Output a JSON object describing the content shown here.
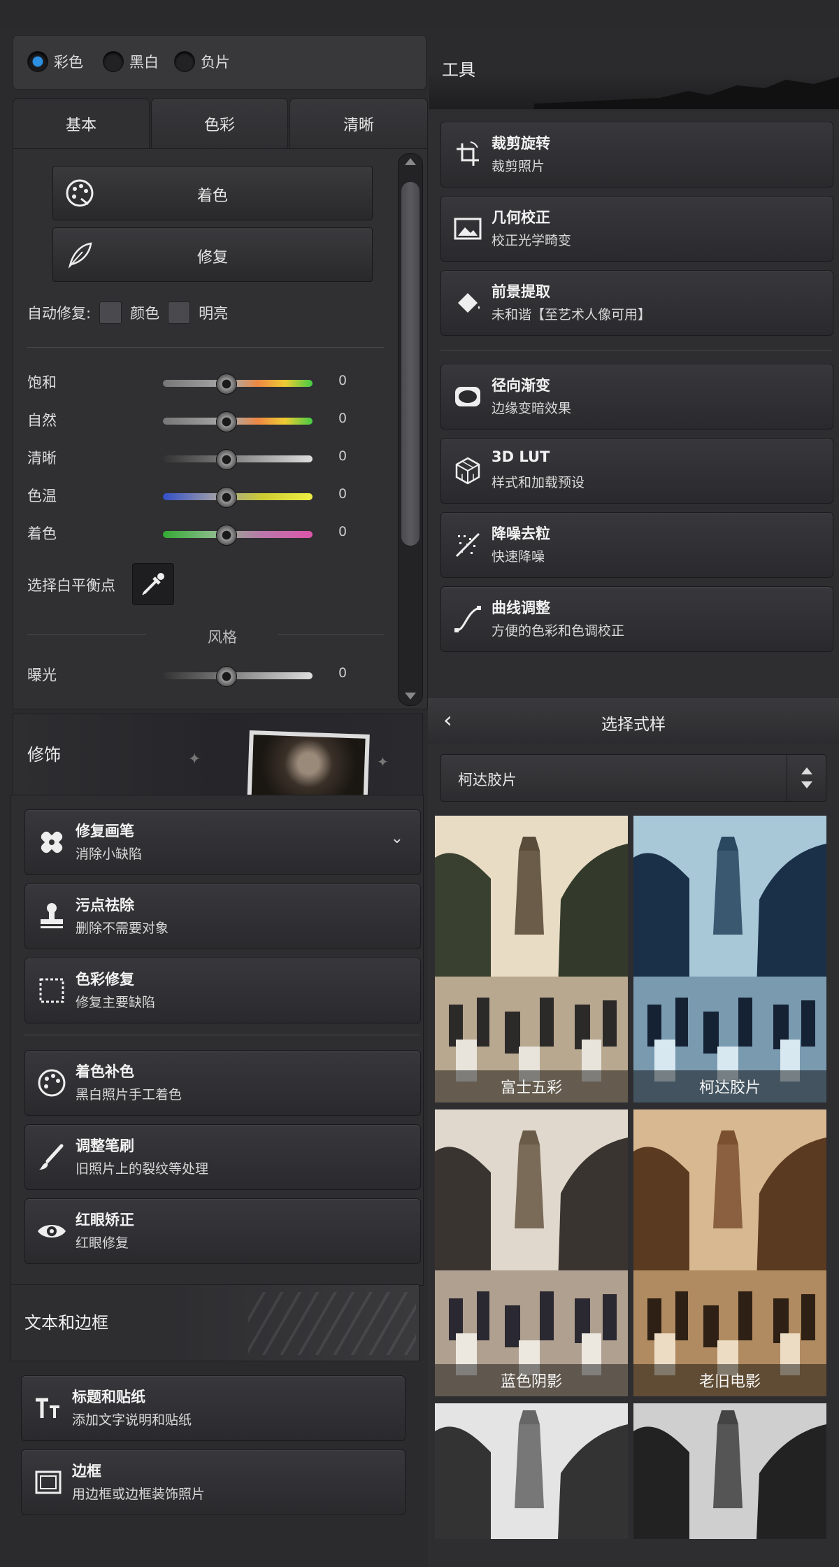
{
  "mode_radios": [
    {
      "label": "彩色",
      "selected": true
    },
    {
      "label": "黑白",
      "selected": false
    },
    {
      "label": "负片",
      "selected": false
    }
  ],
  "tabs": [
    "基本",
    "色彩",
    "清晰"
  ],
  "basic": {
    "colorize_label": "着色",
    "repair_label": "修复",
    "auto_repair_label": "自动修复:",
    "auto_color_label": "颜色",
    "auto_bright_label": "明亮",
    "sliders": [
      {
        "label": "饱和",
        "value": "0"
      },
      {
        "label": "自然",
        "value": "0"
      },
      {
        "label": "清晰",
        "value": "0"
      },
      {
        "label": "色温",
        "value": "0"
      },
      {
        "label": "着色",
        "value": "0"
      }
    ],
    "wb_label": "选择白平衡点",
    "style_header": "风格",
    "exposure_label": "曝光",
    "exposure_value": "0"
  },
  "tools": {
    "title": "工具",
    "items": [
      {
        "title": "裁剪旋转",
        "sub": "裁剪照片",
        "icon": "crop-rotate-icon"
      },
      {
        "title": "几何校正",
        "sub": "校正光学畸变",
        "icon": "geometry-icon"
      },
      {
        "title": "前景提取",
        "sub": "未和谐【至艺术人像可用】",
        "icon": "paint-bucket-icon"
      },
      {
        "title": "径向渐变",
        "sub": "边缘变暗效果",
        "icon": "radial-gradient-icon"
      },
      {
        "title": "3D LUT",
        "sub": "样式和加载预设",
        "icon": "cube-icon"
      },
      {
        "title": "降噪去粒",
        "sub": "快速降噪",
        "icon": "denoise-icon"
      },
      {
        "title": "曲线调整",
        "sub": "方便的色彩和色调校正",
        "icon": "curve-icon"
      }
    ]
  },
  "retouch": {
    "title": "修饰",
    "items": [
      {
        "title": "修复画笔",
        "sub": "消除小缺陷",
        "icon": "bandage-icon",
        "chevron": true
      },
      {
        "title": "污点祛除",
        "sub": "删除不需要对象",
        "icon": "stamp-icon"
      },
      {
        "title": "色彩修复",
        "sub": "修复主要缺陷",
        "icon": "selection-icon"
      },
      {
        "title": "着色补色",
        "sub": "黑白照片手工着色",
        "icon": "palette-icon"
      },
      {
        "title": "调整笔刷",
        "sub": "旧照片上的裂纹等处理",
        "icon": "brush-icon"
      },
      {
        "title": "红眼矫正",
        "sub": "红眼修复",
        "icon": "eye-icon"
      }
    ]
  },
  "text_border": {
    "title": "文本和边框",
    "items": [
      {
        "title": "标题和贴纸",
        "sub": "添加文字说明和贴纸",
        "icon": "text-icon"
      },
      {
        "title": "边框",
        "sub": "用边框或边框装饰照片",
        "icon": "frame-icon"
      }
    ]
  },
  "styles": {
    "title": "选择式样",
    "selected": "柯达胶片",
    "thumbs": [
      {
        "label": "富士五彩",
        "tint": "warm"
      },
      {
        "label": "柯达胶片",
        "tint": "blue"
      },
      {
        "label": "蓝色阴影",
        "tint": "cool"
      },
      {
        "label": "老旧电影",
        "tint": "sepia"
      },
      {
        "label": "",
        "tint": "bw"
      },
      {
        "label": "",
        "tint": "bw"
      }
    ]
  }
}
